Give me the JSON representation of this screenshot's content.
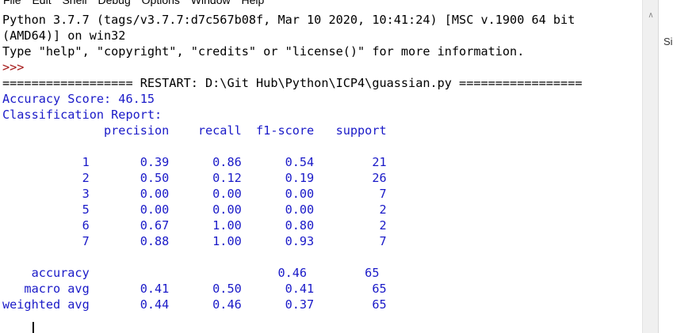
{
  "menu": [
    "File",
    "Edit",
    "Shell",
    "Debug",
    "Options",
    "Window",
    "Help"
  ],
  "shell": {
    "banner_line1": "Python 3.7.7 (tags/v3.7.7:d7c567b08f, Mar 10 2020, 10:41:24) [MSC v.1900 64 bit",
    "banner_line2": "(AMD64)] on win32",
    "banner_line3": "Type \"help\", \"copyright\", \"credits\" or \"license()\" for more information.",
    "prompt": ">>>",
    "restart": "================== RESTART: D:\\Git Hub\\Python\\ICP4\\guassian.py =================",
    "accuracy_score": "Accuracy Score: 46.15",
    "classification_report": "Classification Report:",
    "report_header": "              precision    recall  f1-score   support",
    "report_rows": [
      "           1       0.39      0.86      0.54        21",
      "           2       0.50      0.12      0.19        26",
      "           3       0.00      0.00      0.00         7",
      "           5       0.00      0.00      0.00         2",
      "           6       0.67      1.00      0.80         2",
      "           7       0.88      1.00      0.93         7"
    ],
    "summary_rows": [
      "    accuracy                          0.46        65",
      "   macro avg       0.41      0.50      0.41        65",
      "weighted avg       0.44      0.46      0.37        65"
    ]
  },
  "side_panel": {
    "label": "Si"
  },
  "icons": {
    "scroll_up": "chevron-up-icon"
  }
}
